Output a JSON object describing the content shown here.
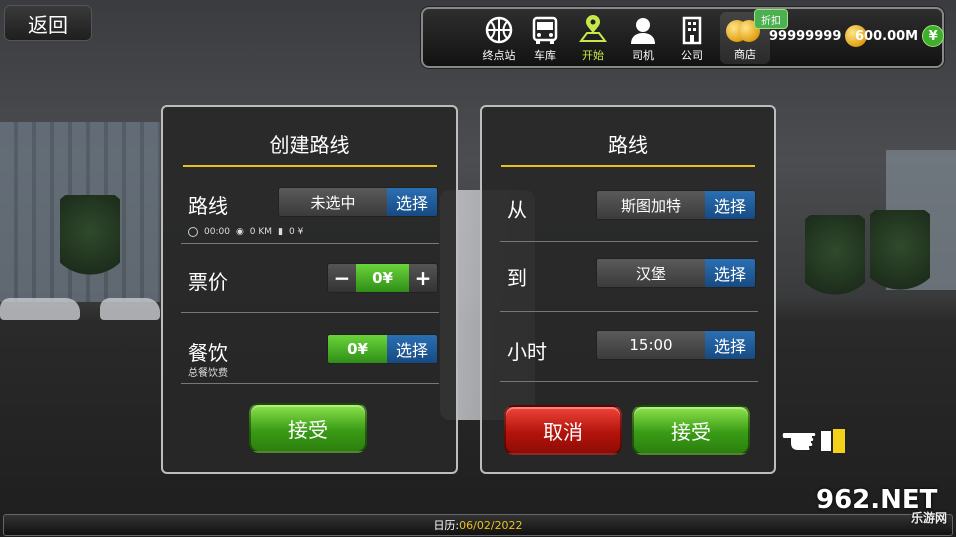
{
  "back_label": "返回",
  "topbar": {
    "nav": [
      {
        "label": "终点站",
        "icon": "basketball-icon"
      },
      {
        "label": "车库",
        "icon": "bus-icon"
      },
      {
        "label": "开始",
        "icon": "map-pin-icon",
        "active": true
      },
      {
        "label": "司机",
        "icon": "driver-icon"
      },
      {
        "label": "公司",
        "icon": "building-icon"
      }
    ],
    "shop_label": "商店",
    "discount_label": "折扣",
    "coins": "99999999",
    "cash": "600.00M",
    "yen_symbol": "¥"
  },
  "create_route": {
    "title": "创建路线",
    "route_label": "路线",
    "route_value": "未选中",
    "select_label": "选择",
    "route_info": {
      "time": "00:00",
      "distance": "0 KM",
      "fuel": "0 ¥"
    },
    "fare_label": "票价",
    "fare_minus": "−",
    "fare_value": "0¥",
    "fare_plus": "+",
    "catering_label": "餐饮",
    "catering_value": "0¥",
    "catering_sub": "总餐饮费",
    "accept_label": "接受"
  },
  "route": {
    "title": "路线",
    "from_label": "从",
    "from_value": "斯图加特",
    "to_label": "到",
    "to_value": "汉堡",
    "hour_label": "小时",
    "hour_value": "15:00",
    "select_label": "选择",
    "cancel_label": "取消",
    "accept_label": "接受"
  },
  "calendar": {
    "label": "日历: ",
    "date": "06/02/2022"
  },
  "watermark": {
    "main": "962.NET",
    "sub": "乐游网"
  },
  "colors": {
    "accent": "#e8c11e",
    "green": "#3a9c16",
    "red": "#b3140c",
    "blue": "#2b6fb3"
  }
}
